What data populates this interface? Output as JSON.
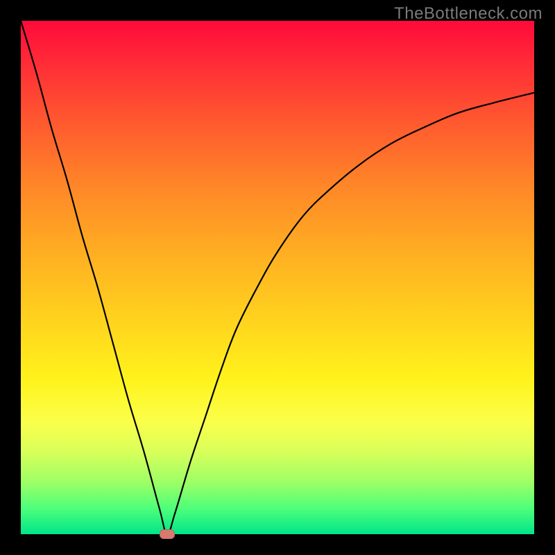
{
  "watermark": "TheBottleneck.com",
  "chart_data": {
    "type": "line",
    "title": "",
    "xlabel": "",
    "ylabel": "",
    "xlim": [
      0,
      100
    ],
    "ylim": [
      0,
      100
    ],
    "grid": false,
    "legend": false,
    "series": [
      {
        "name": "bottleneck-curve",
        "x": [
          0,
          3,
          6,
          9,
          12,
          15,
          18,
          21,
          24,
          27,
          28.5,
          30,
          33,
          36,
          39,
          42,
          46,
          50,
          55,
          60,
          66,
          72,
          78,
          85,
          92,
          100
        ],
        "y": [
          100,
          90,
          79,
          69,
          58,
          48,
          37,
          26,
          16,
          5,
          0,
          4,
          14,
          23,
          32,
          40,
          48,
          55,
          62,
          67,
          72,
          76,
          79,
          82,
          84,
          86
        ]
      }
    ],
    "marker": {
      "x": 28.5,
      "y": 0,
      "name": "optimal-point"
    },
    "background": {
      "type": "vertical-gradient",
      "stops": [
        {
          "pos": 0,
          "color": "#ff0a3a"
        },
        {
          "pos": 50,
          "color": "#ffd21e"
        },
        {
          "pos": 80,
          "color": "#fbff4a"
        },
        {
          "pos": 100,
          "color": "#00e58a"
        }
      ]
    }
  }
}
